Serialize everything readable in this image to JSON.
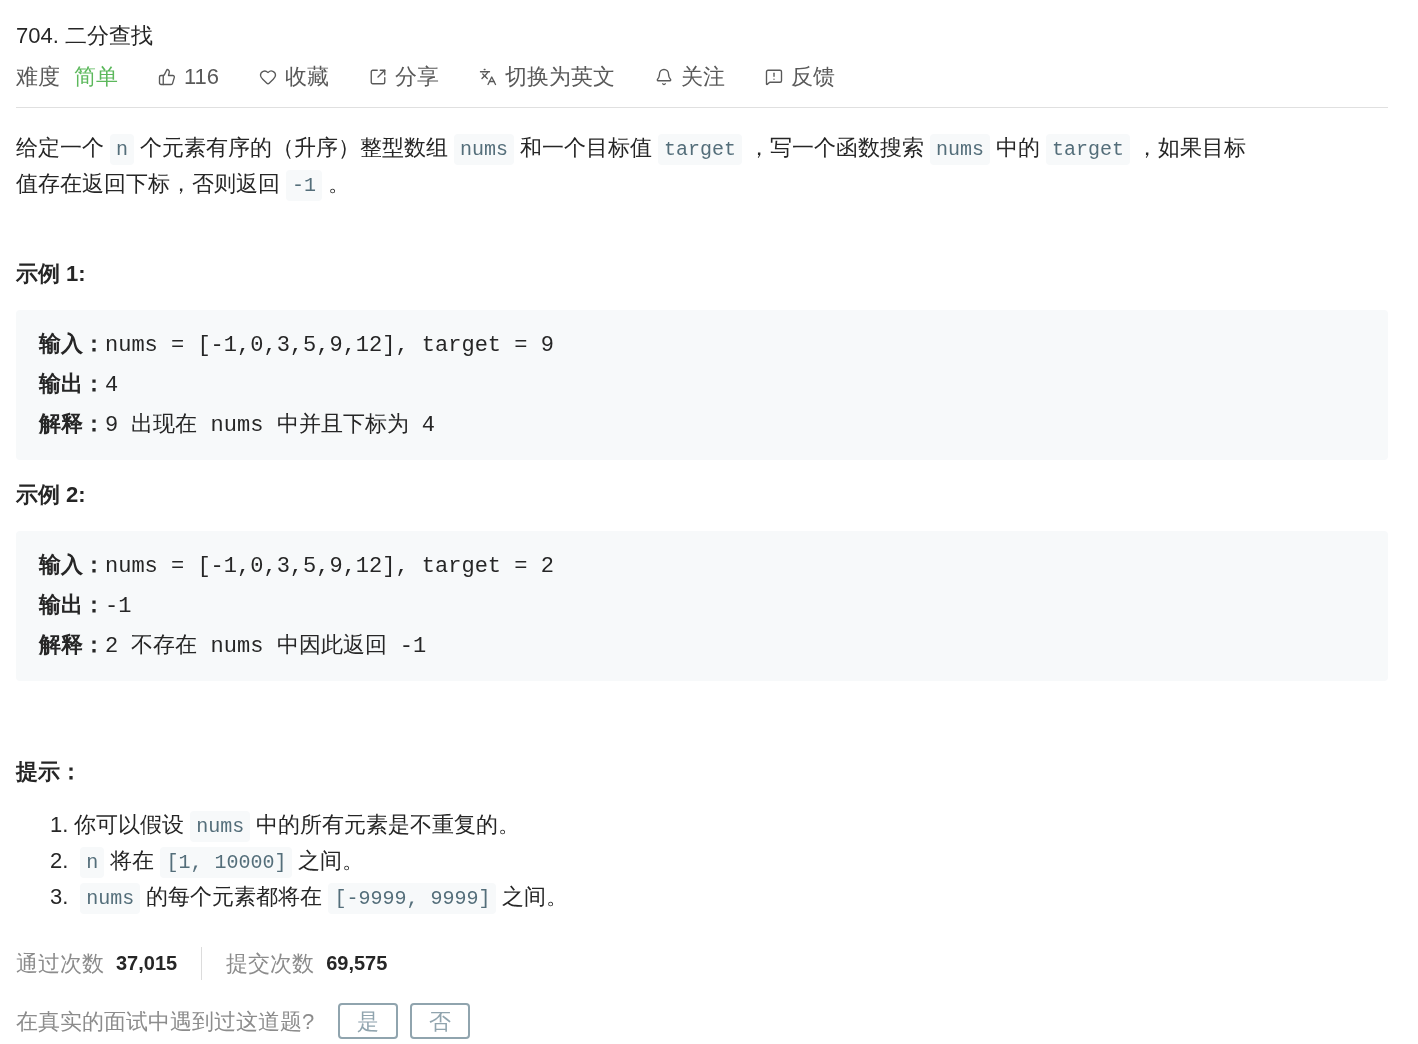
{
  "title": "704. 二分查找",
  "difficulty": {
    "label": "难度",
    "value": "简单",
    "color": "#5cb85c"
  },
  "actions": [
    {
      "kind": "like",
      "label": "116"
    },
    {
      "kind": "heart",
      "label": "收藏"
    },
    {
      "kind": "share",
      "label": "分享"
    },
    {
      "kind": "translate",
      "label": "切换为英文"
    },
    {
      "kind": "bell",
      "label": "关注"
    },
    {
      "kind": "feedback",
      "label": "反馈"
    }
  ],
  "description": [
    {
      "kind": "text",
      "text": "给定一个"
    },
    {
      "kind": "code",
      "text": "n"
    },
    {
      "kind": "text",
      "text": "个元素有序的（升序）整型数组"
    },
    {
      "kind": "code",
      "text": "nums"
    },
    {
      "kind": "text",
      "text": "和一个目标值"
    },
    {
      "kind": "code",
      "text": "target"
    },
    {
      "kind": "text",
      "text": "，写一个函数搜索"
    },
    {
      "kind": "code",
      "text": "nums"
    },
    {
      "kind": "text",
      "text": "中的"
    },
    {
      "kind": "code",
      "text": "target"
    },
    {
      "kind": "text",
      "text": "，如果目标"
    },
    {
      "kind": "text",
      "text": "值存在返回下标，否则返回"
    },
    {
      "kind": "code",
      "text": "-1"
    },
    {
      "kind": "text",
      "text": "。"
    }
  ],
  "examples": [
    {
      "title": "示例 1:",
      "lines": [
        {
          "label": "输入：",
          "value": "nums = [-1,0,3,5,9,12], target = 9"
        },
        {
          "label": "输出：",
          "value": "4"
        },
        {
          "label": "解释：",
          "value": "9 出现在 nums 中并且下标为 4"
        }
      ]
    },
    {
      "title": "示例 2:",
      "lines": [
        {
          "label": "输入：",
          "value": "nums = [-1,0,3,5,9,12], target = 2"
        },
        {
          "label": "输出：",
          "value": "-1"
        },
        {
          "label": "解释：",
          "value": "2 不存在 nums 中因此返回 -1"
        }
      ]
    }
  ],
  "hints_title": "提示：",
  "hints": [
    {
      "marker": "1.",
      "parts": [
        {
          "kind": "text",
          "text": "你可以假设"
        },
        {
          "kind": "code",
          "text": "nums"
        },
        {
          "kind": "text",
          "text": "中的所有元素是不重复的。"
        }
      ]
    },
    {
      "marker": "2.",
      "parts": [
        {
          "kind": "code",
          "text": "n"
        },
        {
          "kind": "text",
          "text": "将在"
        },
        {
          "kind": "code",
          "text": "[1, 10000]"
        },
        {
          "kind": "text",
          "text": "之间。"
        }
      ]
    },
    {
      "marker": "3.",
      "parts": [
        {
          "kind": "code",
          "text": "nums"
        },
        {
          "kind": "text",
          "text": "的每个元素都将在"
        },
        {
          "kind": "code",
          "text": "[-9999, 9999]"
        },
        {
          "kind": "text",
          "text": "之间。"
        }
      ]
    }
  ],
  "stats": [
    {
      "label": "通过次数",
      "value": "37,015"
    },
    {
      "label": "提交次数",
      "value": "69,575"
    }
  ],
  "interview": {
    "question": "在真实的面试中遇到过这道题?",
    "buttons": [
      "是",
      "否"
    ]
  }
}
